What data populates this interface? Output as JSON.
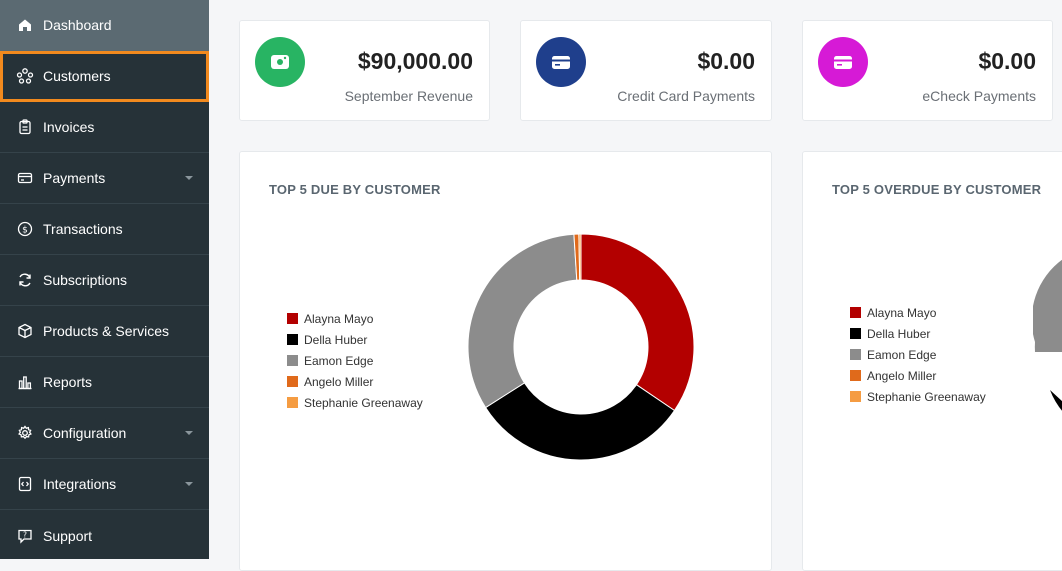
{
  "sidebar": {
    "items": [
      {
        "label": "Dashboard",
        "icon": "home-icon",
        "caret": false
      },
      {
        "label": "Customers",
        "icon": "customers-icon",
        "caret": false
      },
      {
        "label": "Invoices",
        "icon": "clipboard-icon",
        "caret": false
      },
      {
        "label": "Payments",
        "icon": "card-icon",
        "caret": true
      },
      {
        "label": "Transactions",
        "icon": "dollar-circle-icon",
        "caret": false
      },
      {
        "label": "Subscriptions",
        "icon": "refresh-icon",
        "caret": false
      },
      {
        "label": "Products & Services",
        "icon": "box-icon",
        "caret": false
      },
      {
        "label": "Reports",
        "icon": "bar-chart-icon",
        "caret": false
      },
      {
        "label": "Configuration",
        "icon": "gear-icon",
        "caret": true
      },
      {
        "label": "Integrations",
        "icon": "code-icon",
        "caret": true
      },
      {
        "label": "Support",
        "icon": "chat-help-icon",
        "caret": false
      }
    ]
  },
  "stats": [
    {
      "value": "$90,000.00",
      "label": "September Revenue",
      "color": "#28b463",
      "icon": "cash-icon"
    },
    {
      "value": "$0.00",
      "label": "Credit Card Payments",
      "color": "#1f3f8c",
      "icon": "credit-card-icon"
    },
    {
      "value": "$0.00",
      "label": "eCheck Payments",
      "color": "#d61ad6",
      "icon": "credit-card-icon"
    }
  ],
  "charts": {
    "due": {
      "title": "TOP 5 DUE BY CUSTOMER",
      "legend": [
        "Alayna Mayo",
        "Della Huber",
        "Eamon Edge",
        "Angelo Miller",
        "Stephanie Greenaway"
      ]
    },
    "overdue": {
      "title": "TOP 5 OVERDUE BY CUSTOMER",
      "legend": [
        "Alayna Mayo",
        "Della Huber",
        "Eamon Edge",
        "Angelo Miller",
        "Stephanie Greenaway"
      ]
    }
  },
  "chart_data": [
    {
      "type": "pie",
      "title": "TOP 5 DUE BY CUSTOMER",
      "categories": [
        "Alayna Mayo",
        "Della Huber",
        "Eamon Edge",
        "Angelo Miller",
        "Stephanie Greenaway"
      ],
      "values": [
        34.5,
        31.5,
        33.0,
        0.7,
        0.3
      ],
      "colors": [
        "#b30000",
        "#000000",
        "#8c8c8c",
        "#e06a1b",
        "#f59c42"
      ],
      "legend": "left"
    },
    {
      "type": "pie",
      "title": "TOP 5 OVERDUE BY CUSTOMER",
      "categories": [
        "Alayna Mayo",
        "Della Huber",
        "Eamon Edge",
        "Angelo Miller",
        "Stephanie Greenaway"
      ],
      "colors": [
        "#b30000",
        "#000000",
        "#8c8c8c",
        "#e06a1b",
        "#f59c42"
      ],
      "legend": "left"
    }
  ]
}
